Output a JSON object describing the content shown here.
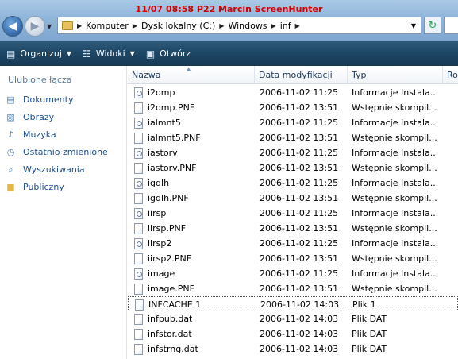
{
  "overlay": "11/07  08:58  P22  Marcin  ScreenHunter",
  "address": {
    "crumbs": [
      "Komputer",
      "Dysk lokalny (C:)",
      "Windows",
      "inf"
    ]
  },
  "toolbar": {
    "organize": "Organizuj",
    "views": "Widoki",
    "open": "Otwórz"
  },
  "navpane": {
    "header": "Ulubione łącza",
    "items": [
      {
        "label": "Dokumenty",
        "icon": "documents-icon",
        "color": "#4a7cc0"
      },
      {
        "label": "Obrazy",
        "icon": "pictures-icon",
        "color": "#4b8bd0"
      },
      {
        "label": "Muzyka",
        "icon": "music-icon",
        "color": "#3d78c2"
      },
      {
        "label": "Ostatnio zmienione",
        "icon": "recent-icon",
        "color": "#5a86c5"
      },
      {
        "label": "Wyszukiwania",
        "icon": "search-folder-icon",
        "color": "#4a7cc0"
      },
      {
        "label": "Publiczny",
        "icon": "folder-icon",
        "color": "#e3b646"
      }
    ]
  },
  "columns": [
    "Nazwa",
    "Data modyfikacji",
    "Typ",
    "Ro"
  ],
  "files": [
    {
      "name": "i2omp",
      "date": "2006-11-02 11:25",
      "type": "Informacje Instala...",
      "icon": "gear"
    },
    {
      "name": "i2omp.PNF",
      "date": "2006-11-02 13:51",
      "type": "Wstępnie skompil...",
      "icon": "doc"
    },
    {
      "name": "ialmnt5",
      "date": "2006-11-02 11:25",
      "type": "Informacje Instala...",
      "icon": "gear"
    },
    {
      "name": "ialmnt5.PNF",
      "date": "2006-11-02 13:51",
      "type": "Wstępnie skompil...",
      "icon": "doc"
    },
    {
      "name": "iastorv",
      "date": "2006-11-02 11:25",
      "type": "Informacje Instala...",
      "icon": "gear"
    },
    {
      "name": "iastorv.PNF",
      "date": "2006-11-02 13:51",
      "type": "Wstępnie skompil...",
      "icon": "doc"
    },
    {
      "name": "igdlh",
      "date": "2006-11-02 11:25",
      "type": "Informacje Instala...",
      "icon": "gear"
    },
    {
      "name": "igdlh.PNF",
      "date": "2006-11-02 13:51",
      "type": "Wstępnie skompil...",
      "icon": "doc"
    },
    {
      "name": "iirsp",
      "date": "2006-11-02 11:25",
      "type": "Informacje Instala...",
      "icon": "gear"
    },
    {
      "name": "iirsp.PNF",
      "date": "2006-11-02 13:51",
      "type": "Wstępnie skompil...",
      "icon": "doc"
    },
    {
      "name": "iirsp2",
      "date": "2006-11-02 11:25",
      "type": "Informacje Instala...",
      "icon": "gear"
    },
    {
      "name": "iirsp2.PNF",
      "date": "2006-11-02 13:51",
      "type": "Wstępnie skompil...",
      "icon": "doc"
    },
    {
      "name": "image",
      "date": "2006-11-02 11:25",
      "type": "Informacje Instala...",
      "icon": "gear"
    },
    {
      "name": "image.PNF",
      "date": "2006-11-02 13:51",
      "type": "Wstępnie skompil...",
      "icon": "doc"
    },
    {
      "name": "INFCACHE.1",
      "date": "2006-11-02 14:03",
      "type": "Plik 1",
      "icon": "doc",
      "focused": true
    },
    {
      "name": "infpub.dat",
      "date": "2006-11-02 14:03",
      "type": "Plik DAT",
      "icon": "doc"
    },
    {
      "name": "infstor.dat",
      "date": "2006-11-02 14:03",
      "type": "Plik DAT",
      "icon": "doc"
    },
    {
      "name": "infstrng.dat",
      "date": "2006-11-02 14:03",
      "type": "Plik DAT",
      "icon": "doc"
    }
  ]
}
